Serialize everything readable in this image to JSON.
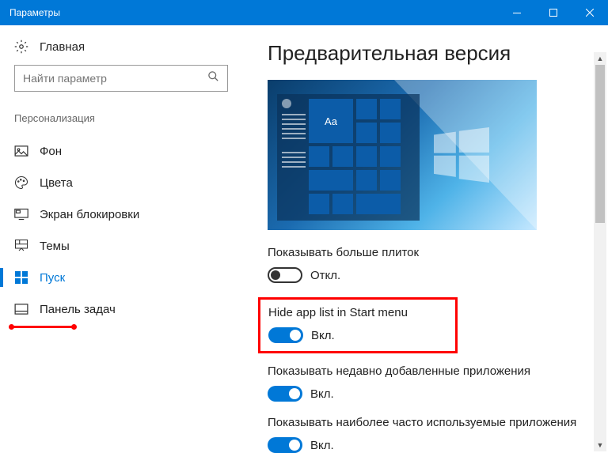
{
  "window": {
    "title": "Параметры"
  },
  "sidebar": {
    "home": "Главная",
    "search_placeholder": "Найти параметр",
    "section": "Персонализация",
    "items": [
      {
        "label": "Фон"
      },
      {
        "label": "Цвета"
      },
      {
        "label": "Экран блокировки"
      },
      {
        "label": "Темы"
      },
      {
        "label": "Пуск"
      },
      {
        "label": "Панель задач"
      }
    ]
  },
  "main": {
    "heading": "Предварительная версия",
    "preview_tile_text": "Aa",
    "settings": [
      {
        "label": "Показывать больше плиток",
        "state": "Откл.",
        "on": false
      },
      {
        "label": "Hide app list in Start menu",
        "state": "Вкл.",
        "on": true,
        "highlighted": true
      },
      {
        "label": "Показывать недавно добавленные приложения",
        "state": "Вкл.",
        "on": true
      },
      {
        "label": "Показывать наиболее часто используемые приложения",
        "state": "Вкл.",
        "on": true
      }
    ]
  }
}
